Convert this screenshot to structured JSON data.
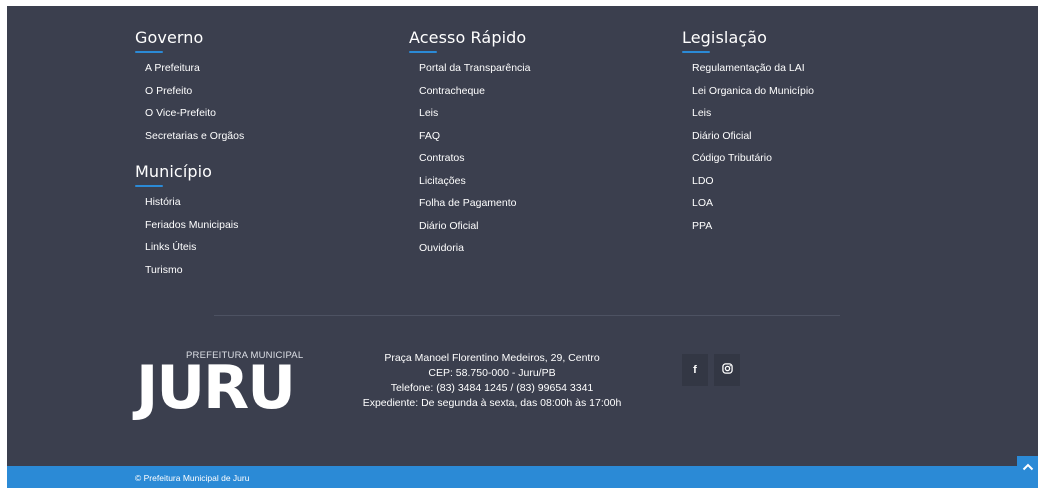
{
  "governo": {
    "title": "Governo",
    "items": [
      "A Prefeitura",
      "O Prefeito",
      "O Vice-Prefeito",
      "Secretarias e Orgãos"
    ]
  },
  "municipio": {
    "title": "Município",
    "items": [
      "História",
      "Feriados Municipais",
      "Links Úteis",
      "Turismo"
    ]
  },
  "acesso_rapido": {
    "title": "Acesso Rápido",
    "items": [
      "Portal da Transparência",
      "Contracheque",
      "Leis",
      "FAQ",
      "Contratos",
      "Licitações",
      "Folha de Pagamento",
      "Diário Oficial",
      "Ouvidoria"
    ]
  },
  "legislacao": {
    "title": "Legislação",
    "items": [
      "Regulamentação da LAI",
      "Lei Organica do Município",
      "Leis",
      "Diário Oficial",
      "Código Tributário",
      "LDO",
      "LOA",
      "PPA"
    ]
  },
  "logo": {
    "subtitle": "PREFEITURA MUNICIPAL",
    "name": "JURU"
  },
  "address": {
    "line1": "Praça Manoel Florentino Medeiros, 29, Centro",
    "line2": "CEP: 58.750-000 - Juru/PB",
    "line3": "Telefone: (83) 3484 1245 / (83) 99654 3341",
    "line4": "Expediente: De segunda à sexta, das 08:00h às 17:00h"
  },
  "social": [
    {
      "icon": "facebook-icon",
      "glyph": "f"
    },
    {
      "icon": "instagram-icon",
      "glyph": ""
    }
  ],
  "copyright": "© Prefeitura Municipal de Juru",
  "colors": {
    "footer_bg": "#3b3f4e",
    "accent": "#2b8ad6"
  }
}
